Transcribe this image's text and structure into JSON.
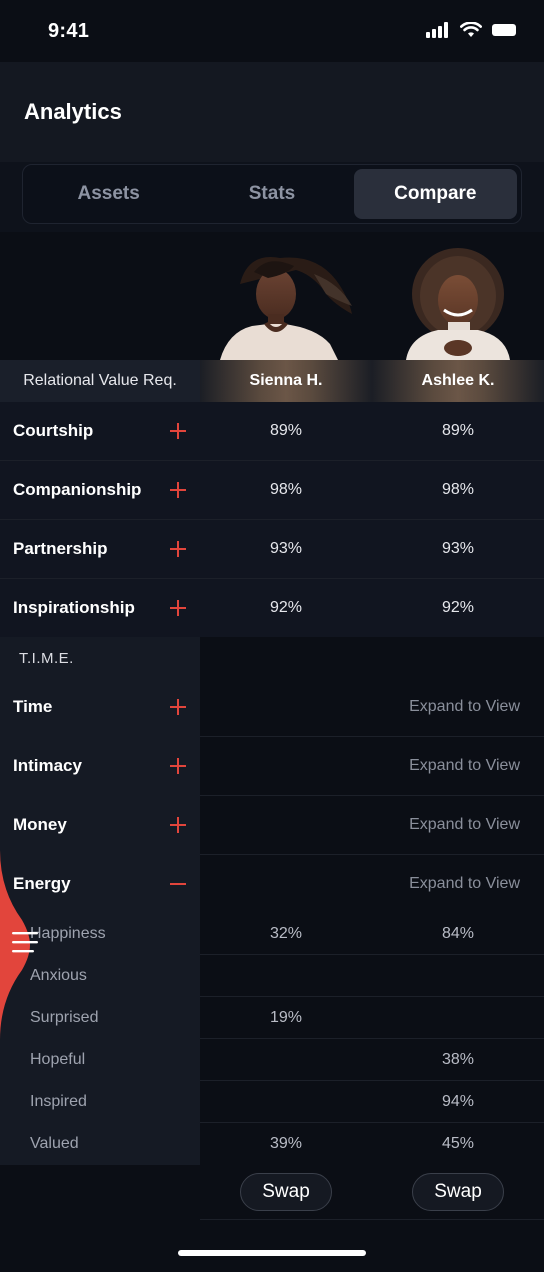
{
  "status": {
    "time": "9:41"
  },
  "header": {
    "title": "Analytics"
  },
  "tabs": [
    {
      "label": "Assets",
      "active": false
    },
    {
      "label": "Stats",
      "active": false
    },
    {
      "label": "Compare",
      "active": true
    }
  ],
  "table": {
    "header_label": "Relational Value Req.",
    "people": [
      "Sienna H.",
      "Ashlee K."
    ],
    "rows": [
      {
        "label": "Courtship",
        "values": [
          "89%",
          "89%"
        ]
      },
      {
        "label": "Companionship",
        "values": [
          "98%",
          "98%"
        ]
      },
      {
        "label": "Partnership",
        "values": [
          "93%",
          "93%"
        ]
      },
      {
        "label": "Inspirationship",
        "values": [
          "92%",
          "92%"
        ]
      }
    ]
  },
  "time_section": {
    "title": "T.I.M.E.",
    "rows": [
      {
        "label": "Time",
        "expand": "Expand to View",
        "expanded": false
      },
      {
        "label": "Intimacy",
        "expand": "Expand to View",
        "expanded": false
      },
      {
        "label": "Money",
        "expand": "Expand to View",
        "expanded": false
      },
      {
        "label": "Energy",
        "expand": "Expand to View",
        "expanded": true
      }
    ],
    "energy_items": [
      {
        "label": "Happiness",
        "values": [
          "32%",
          "84%"
        ]
      },
      {
        "label": "Anxious",
        "values": [
          "",
          ""
        ]
      },
      {
        "label": "Surprised",
        "values": [
          "19%",
          ""
        ]
      },
      {
        "label": "Hopeful",
        "values": [
          "",
          "38%"
        ]
      },
      {
        "label": "Inspired",
        "values": [
          "",
          "94%"
        ]
      },
      {
        "label": "Valued",
        "values": [
          "39%",
          "45%"
        ]
      }
    ]
  },
  "swap_label": "Swap",
  "colors": {
    "accent": "#e2453c",
    "background": "#0b0e15"
  }
}
